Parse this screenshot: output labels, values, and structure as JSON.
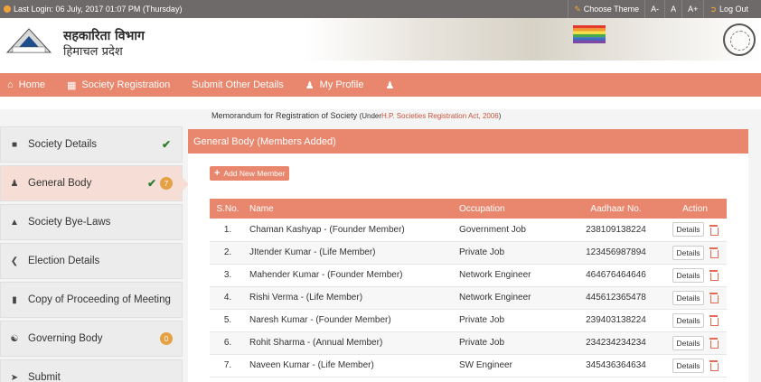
{
  "topbar": {
    "last_login": "Last Login:  06 July, 2017 01:07 PM (Thursday)",
    "choose_theme": "Choose Theme",
    "font_small": "A-",
    "font_normal": "A",
    "font_large": "A+",
    "logout": "Log Out"
  },
  "header": {
    "title": "सहकारिता विभाग",
    "subtitle": "हिमाचल प्रदेश"
  },
  "nav": {
    "home": "Home",
    "society_registration": "Society Registration",
    "submit_other": "Submit Other Details",
    "my_profile": "My Profile"
  },
  "sidebar": {
    "items": [
      {
        "label": "Society Details",
        "icon": "book-icon",
        "check": "✔"
      },
      {
        "label": "General Body",
        "icon": "users-icon",
        "check": "✔",
        "badge": "7"
      },
      {
        "label": "Society Bye-Laws",
        "icon": "graduation-cap-icon"
      },
      {
        "label": "Election Details",
        "icon": "share-icon"
      },
      {
        "label": "Copy of Proceeding of Meeting",
        "icon": "file-icon"
      },
      {
        "label": "Governing Body",
        "icon": "bank-icon",
        "badge": "0"
      },
      {
        "label": "Submit",
        "icon": "send-icon"
      }
    ]
  },
  "main": {
    "caption_text": "Memorandum for Registration of Society",
    "caption_under": "(Under",
    "caption_act": "H.P. Societies Registration Act, 2006",
    "caption_close": ")",
    "panel_title": "General Body (Members Added)",
    "add_button": "Add New Member",
    "columns": [
      "S.No.",
      "Name",
      "Occupation",
      "Aadhaar No.",
      "Action"
    ],
    "details_label": "Details",
    "rows": [
      {
        "sno": "1.",
        "name": "Chaman Kashyap - (Founder Member)",
        "occupation": "Government Job",
        "aadhaar": "238109138224"
      },
      {
        "sno": "2.",
        "name": "JItender Kumar - (Life Member)",
        "occupation": "Private Job",
        "aadhaar": "123456987894"
      },
      {
        "sno": "3.",
        "name": "Mahender Kumar - (Founder Member)",
        "occupation": "Network Engineer",
        "aadhaar": "464676464646"
      },
      {
        "sno": "4.",
        "name": "Rishi Verma - (Life Member)",
        "occupation": "Network Engineer",
        "aadhaar": "445612365478"
      },
      {
        "sno": "5.",
        "name": "Naresh Kumar - (Founder Member)",
        "occupation": "Private Job",
        "aadhaar": "239403138224"
      },
      {
        "sno": "6.",
        "name": "Rohit Sharma - (Annual Member)",
        "occupation": "Private Job",
        "aadhaar": "234234234234"
      },
      {
        "sno": "7.",
        "name": "Naveen Kumar - (Life Member)",
        "occupation": "SW Engineer",
        "aadhaar": "345436364634"
      }
    ]
  },
  "colors": {
    "accent": "#e8876d",
    "topbar": "#6e6a69",
    "active_item": "#f6ded6",
    "check": "#2f7d2f",
    "badge": "#e6a145"
  }
}
